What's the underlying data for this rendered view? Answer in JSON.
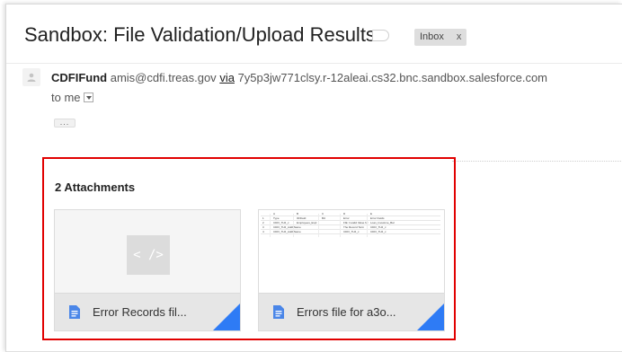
{
  "subject": "Sandbox: File Validation/Upload Results",
  "inbox_label": "Inbox",
  "inbox_remove": "x",
  "sender": {
    "name": "CDFIFund",
    "email": "amis@cdfi.treas.gov",
    "via": "via",
    "relay": "7y5p3jw771clsy.r-12aleai.cs32.bnc.sandbox.salesforce.com"
  },
  "recipient": "to me",
  "more_label": "...",
  "attachments": {
    "title": "2 Attachments",
    "items": [
      {
        "name": "Error Records fil...",
        "preview": "< />"
      },
      {
        "name": "Errors file for a3o...",
        "preview": "spreadsheet"
      }
    ]
  },
  "sheet_rows": [
    [
      "",
      "A",
      "B",
      "C",
      "D",
      "E"
    ],
    [
      "1",
      "Type",
      "ID/Field",
      "Biz",
      "Error",
      "Error Fields"
    ],
    [
      "2",
      "CDFI_TLR_c",
      "Employees_Expl",
      "",
      "FIE: Invalid Value for",
      "Loan_Investme_Bal"
    ],
    [
      "3",
      "CDFI_TLR_Addl Name",
      "",
      "",
      "The Record Term",
      "CDFI_TLR_c"
    ],
    [
      "4",
      "CDFI_TLR_Addl Name",
      "",
      "",
      "CDFI_TLR_c",
      "CDFI_TLR_c"
    ]
  ],
  "colors": {
    "highlight": "#e10000",
    "corner": "#2e7bf5",
    "file_icon": "#4a86e8"
  },
  "icons": {
    "avatar": "person-icon",
    "label": "label-tag-icon",
    "dropdown": "chevron-down-icon",
    "file": "document-icon"
  }
}
